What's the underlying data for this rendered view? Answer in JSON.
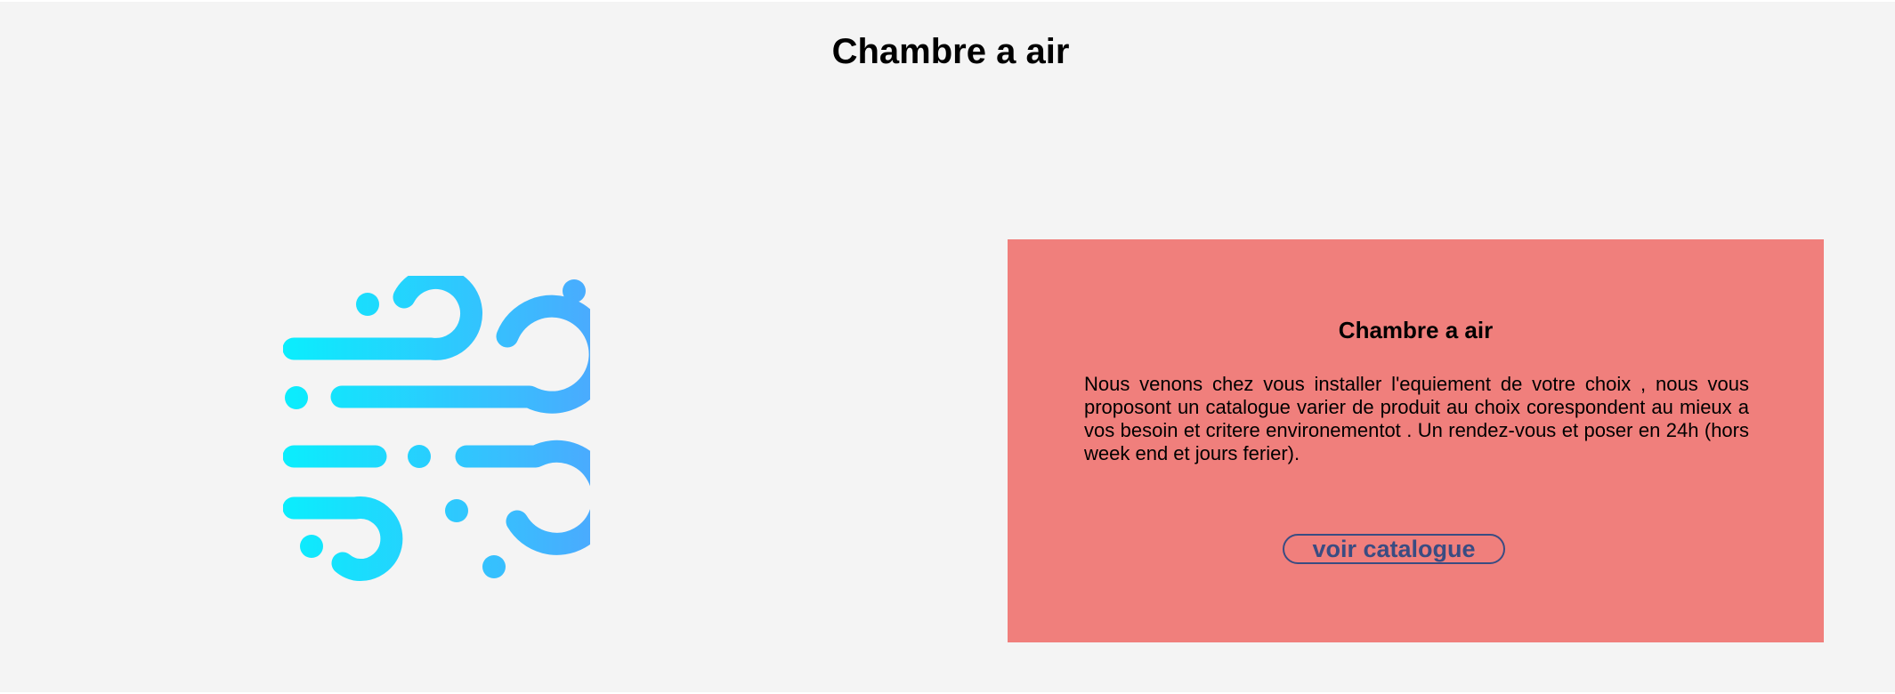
{
  "page": {
    "title": "Chambre a air"
  },
  "logo": {
    "icon": "wind-icon",
    "gradient": [
      "#0aeefd",
      "#4aabfe"
    ]
  },
  "card": {
    "title": "Chambre a air",
    "text": "Nous venons chez vous installer l'equiement de votre choix , nous vous proposont un catalogue varier de produit au choix corespondent au mieux a vos besoin et critere environementot . Un rendez-vous et poser en 24h (hors week end et jours ferier).",
    "button_label": "voir catalogue",
    "background_color": "#f07f7c",
    "button_color": "#3a4c82"
  }
}
